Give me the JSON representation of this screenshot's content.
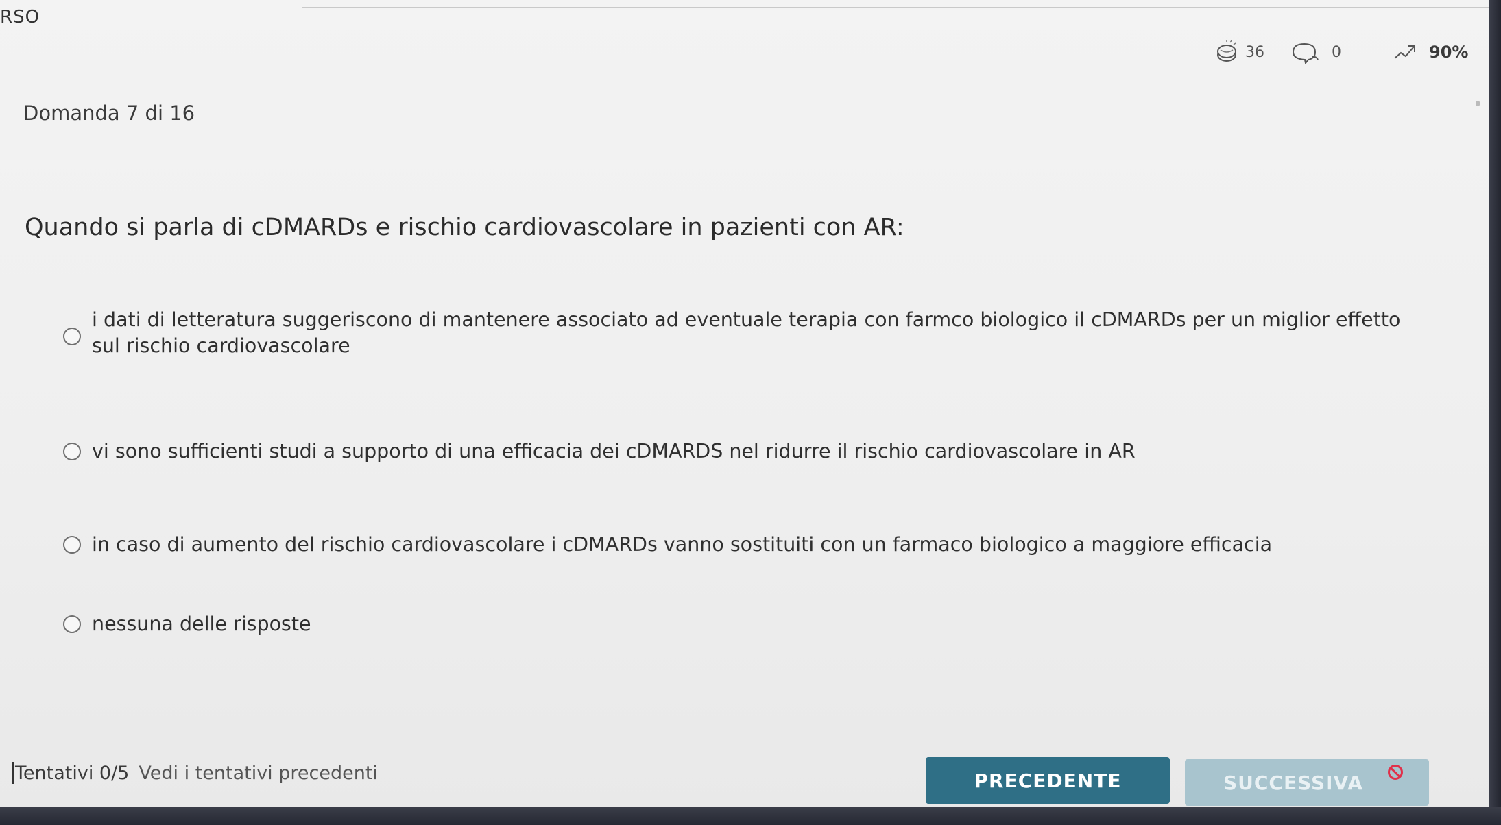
{
  "header": {
    "course_fragment": "RSO"
  },
  "stats": {
    "coins": "36",
    "comments": "0",
    "progress": "90%"
  },
  "question": {
    "counter": "Domanda 7 di 16",
    "text": "Quando si parla di cDMARDs e rischio cardiovascolare in pazienti con AR:",
    "options": [
      "i dati di letteratura suggeriscono di mantenere associato ad eventuale terapia con farmco biologico il cDMARDs per un miglior effetto sul rischio cardiovascolare",
      "vi sono sufficienti studi a supporto di una efficacia dei cDMARDS nel ridurre il rischio cardiovascolare in AR",
      "in caso di aumento del rischio cardiovascolare i cDMARDs vanno sostituiti con un farmaco biologico a maggiore efficacia",
      "nessuna delle risposte"
    ]
  },
  "footer": {
    "attempts": "Tentativi 0/5",
    "attempts_link": "Vedi i tentativi precedenti",
    "prev_label": "PRECEDENTE",
    "next_label": "SUCCESSIVA"
  },
  "colors": {
    "primary_button": "#2f6f86",
    "disabled_button": "#a8c4ce",
    "ban_icon": "#e0304a"
  },
  "icons": [
    "coins-icon",
    "comment-icon",
    "trend-up-icon",
    "ban-icon"
  ]
}
